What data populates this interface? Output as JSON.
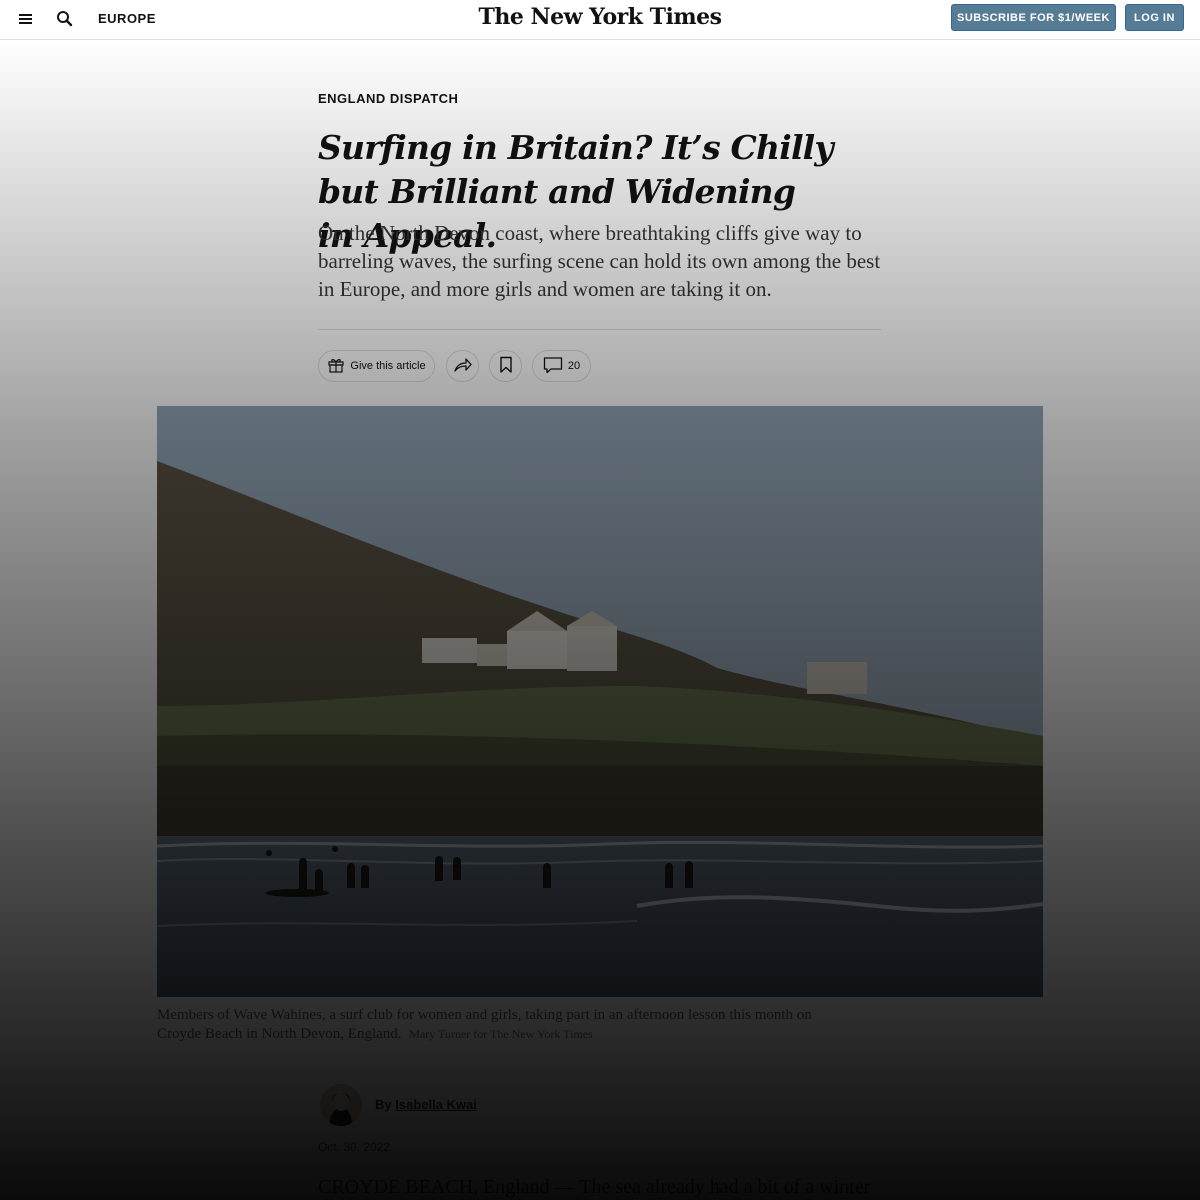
{
  "header": {
    "menu_icon": "hamburger-menu-icon",
    "search_icon": "search-icon",
    "section": "EUROPE",
    "logo": "The New York Times",
    "subscribe_label": "SUBSCRIBE FOR $1/WEEK",
    "login_label": "LOG IN",
    "button_color": "#567b95"
  },
  "article": {
    "kicker": "ENGLAND DISPATCH",
    "headline": "Surfing in Britain? It’s Chilly but Brilliant and Widening in Appeal.",
    "summary": "On the North Devon coast, where breathtaking cliffs give way to barreling waves, the surfing scene can hold its own among the best in Europe, and more girls and women are taking it on.",
    "tools": {
      "gift_label": "Give this article",
      "gift_icon": "gift-icon",
      "share_icon": "share-icon",
      "save_icon": "bookmark-icon",
      "comment_icon": "comment-icon",
      "comment_count": "20"
    },
    "photo": {
      "caption": "Members of Wave Wahines, a surf club for women and girls, taking part in an afternoon lesson this month on Croyde Beach in North Devon, England.",
      "credit": "Mary Turner for The New York Times"
    },
    "byline": {
      "prefix": "By",
      "author": "Isabella Kwai"
    },
    "date": "Oct. 30, 2022",
    "lede": "CROYDE BEACH, England — The sea already had a bit of a winter"
  }
}
